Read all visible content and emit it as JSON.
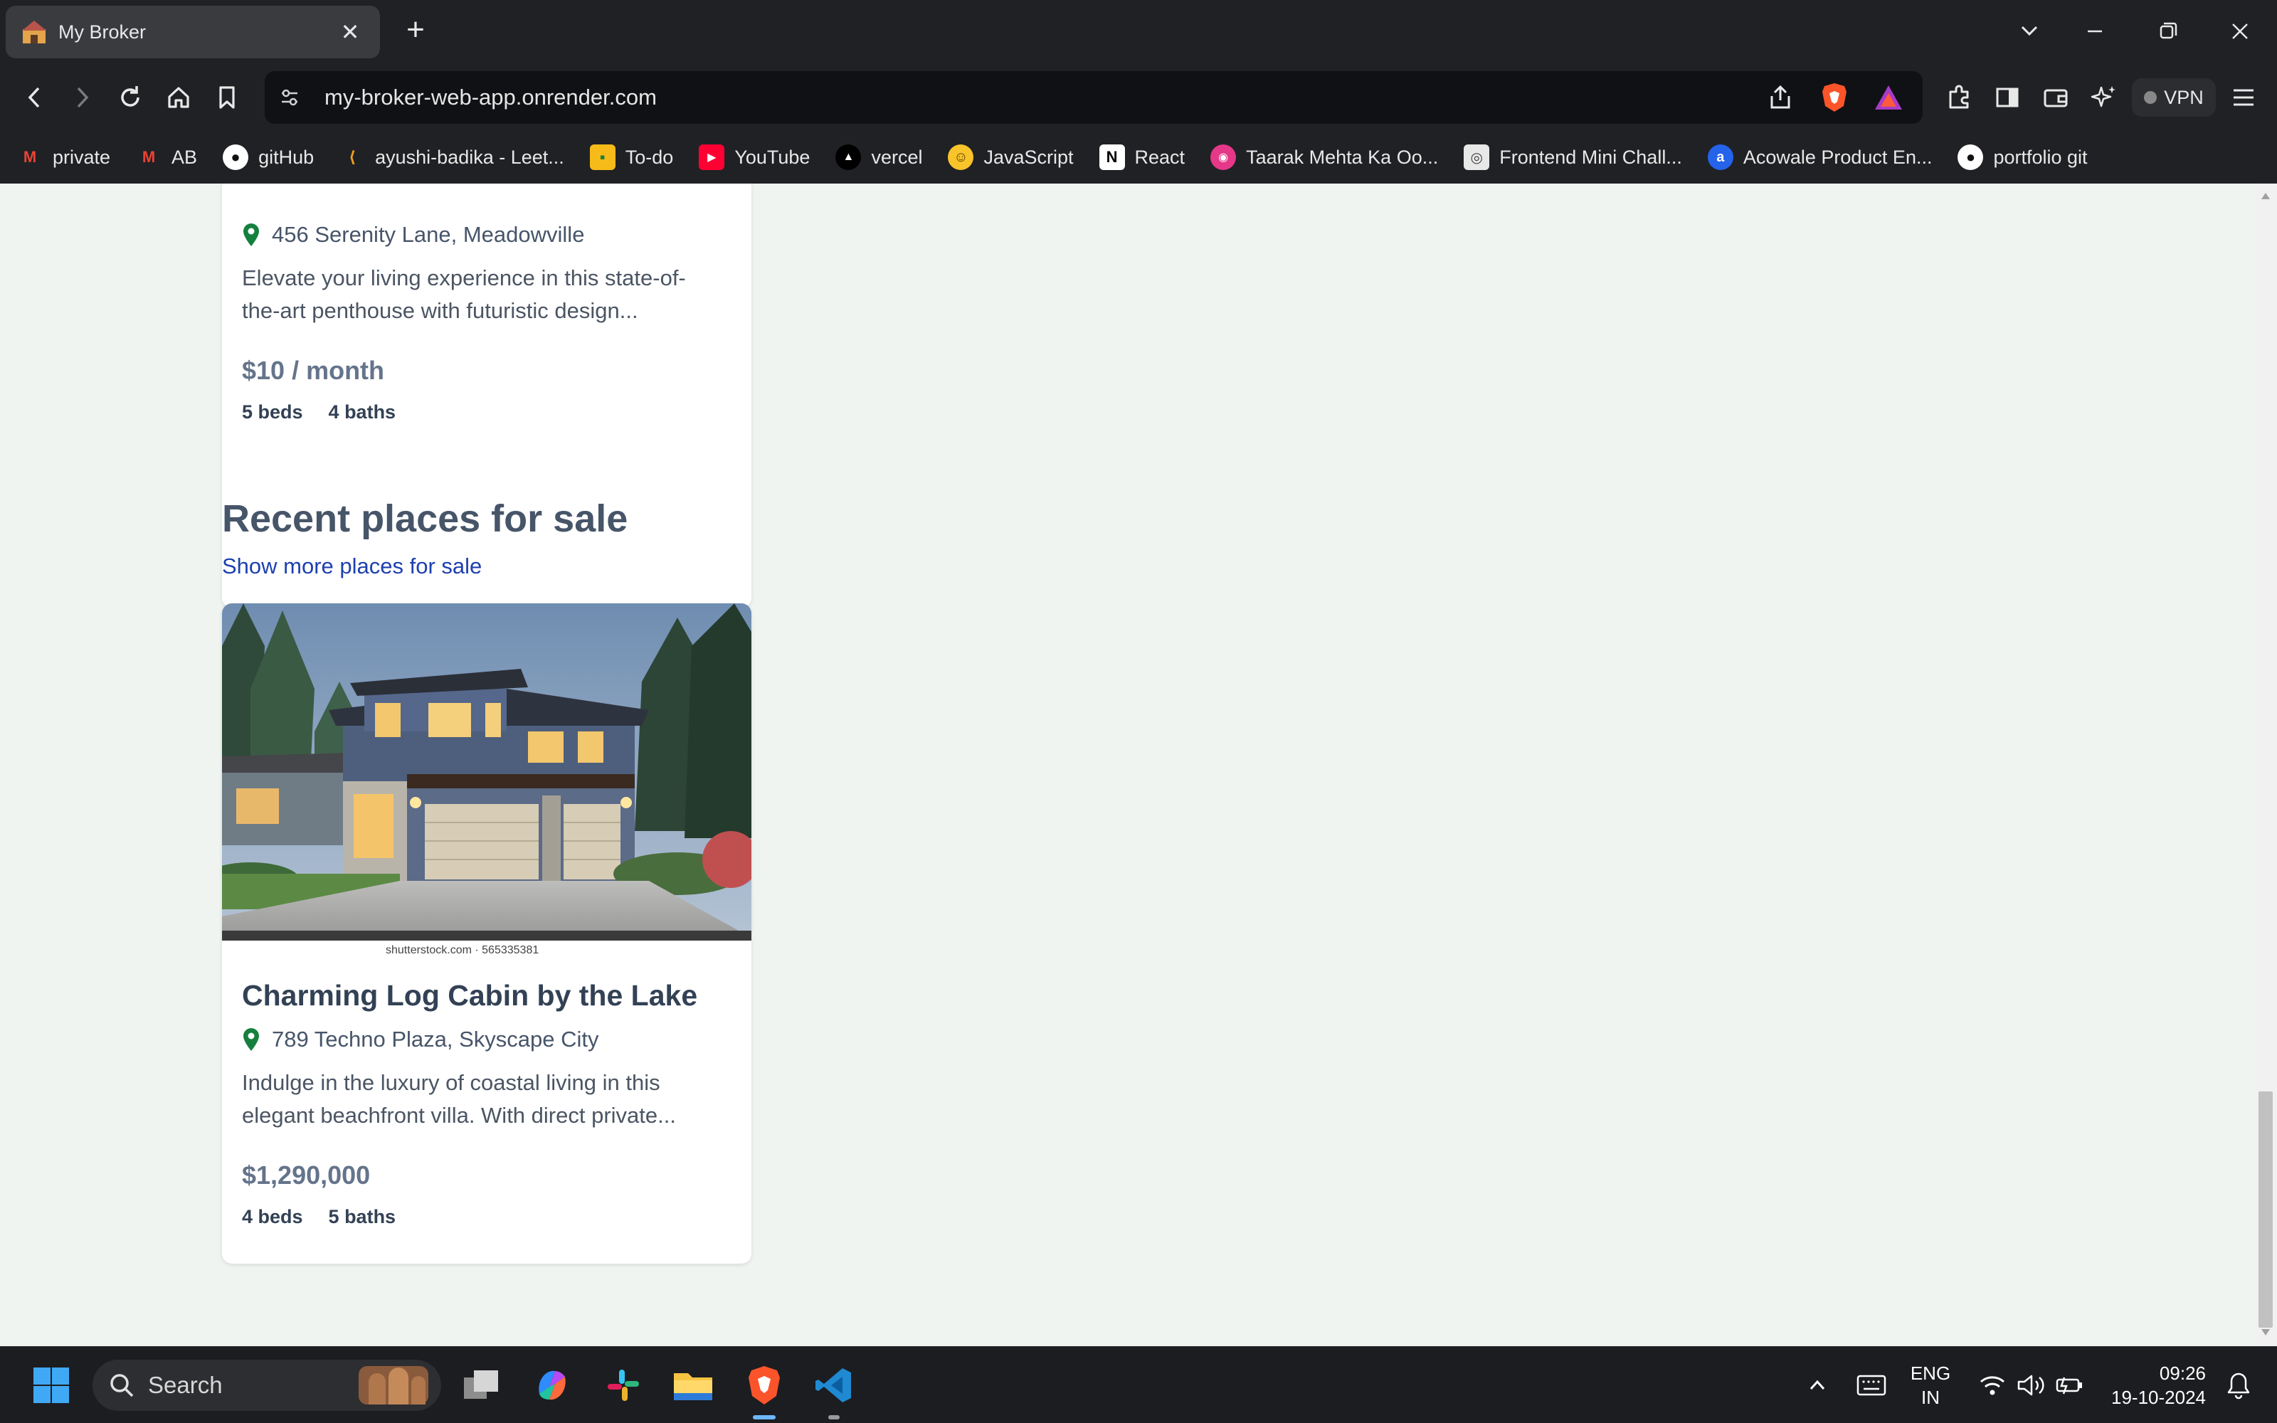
{
  "browser": {
    "tab_title": "My Broker",
    "url": "my-broker-web-app.onrender.com",
    "vpn_label": "VPN",
    "bookmarks": [
      {
        "label": "private",
        "icon": "gmail-icon"
      },
      {
        "label": "AB",
        "icon": "gmail-icon"
      },
      {
        "label": "gitHub",
        "icon": "github-icon"
      },
      {
        "label": "ayushi-badika - Leet...",
        "icon": "leetcode-icon"
      },
      {
        "label": "To-do",
        "icon": "classroom-icon"
      },
      {
        "label": "YouTube",
        "icon": "youtube-icon"
      },
      {
        "label": "vercel",
        "icon": "vercel-icon"
      },
      {
        "label": "JavaScript",
        "icon": "emoji-icon"
      },
      {
        "label": "React",
        "icon": "notion-icon"
      },
      {
        "label": "Taarak Mehta Ka Oo...",
        "icon": "channel-icon"
      },
      {
        "label": "Frontend Mini Chall...",
        "icon": "frontend-icon"
      },
      {
        "label": "Acowale Product En...",
        "icon": "acowale-icon"
      },
      {
        "label": "portfolio git",
        "icon": "github-icon"
      }
    ]
  },
  "page": {
    "rent_card": {
      "address": "456 Serenity Lane, Meadowville",
      "description_line1": "Elevate your living experience in this state-of-",
      "description_line2": "the-art penthouse with futuristic design...",
      "price": "$10 / month",
      "beds": "5 beds",
      "baths": "4 baths"
    },
    "sale_section": {
      "title": "Recent places for sale",
      "link": "Show more places for sale"
    },
    "sale_card": {
      "title": "Charming Log Cabin by the Lake",
      "address": "789 Techno Plaza, Skyscape City",
      "description_line1": "Indulge in the luxury of coastal living in this",
      "description_line2": "elegant beachfront villa. With direct private...",
      "price": "$1,290,000",
      "beds": "4 beds",
      "baths": "5 baths",
      "watermark": "shutterstock.com · 565335381"
    }
  },
  "taskbar": {
    "search_label": "Search",
    "lang_line1": "ENG",
    "lang_line2": "IN",
    "time": "09:26",
    "date": "19-10-2024"
  },
  "colors": {
    "page_bg": "#eff4f0",
    "link": "#1e40af",
    "location_pin": "#15803d"
  }
}
